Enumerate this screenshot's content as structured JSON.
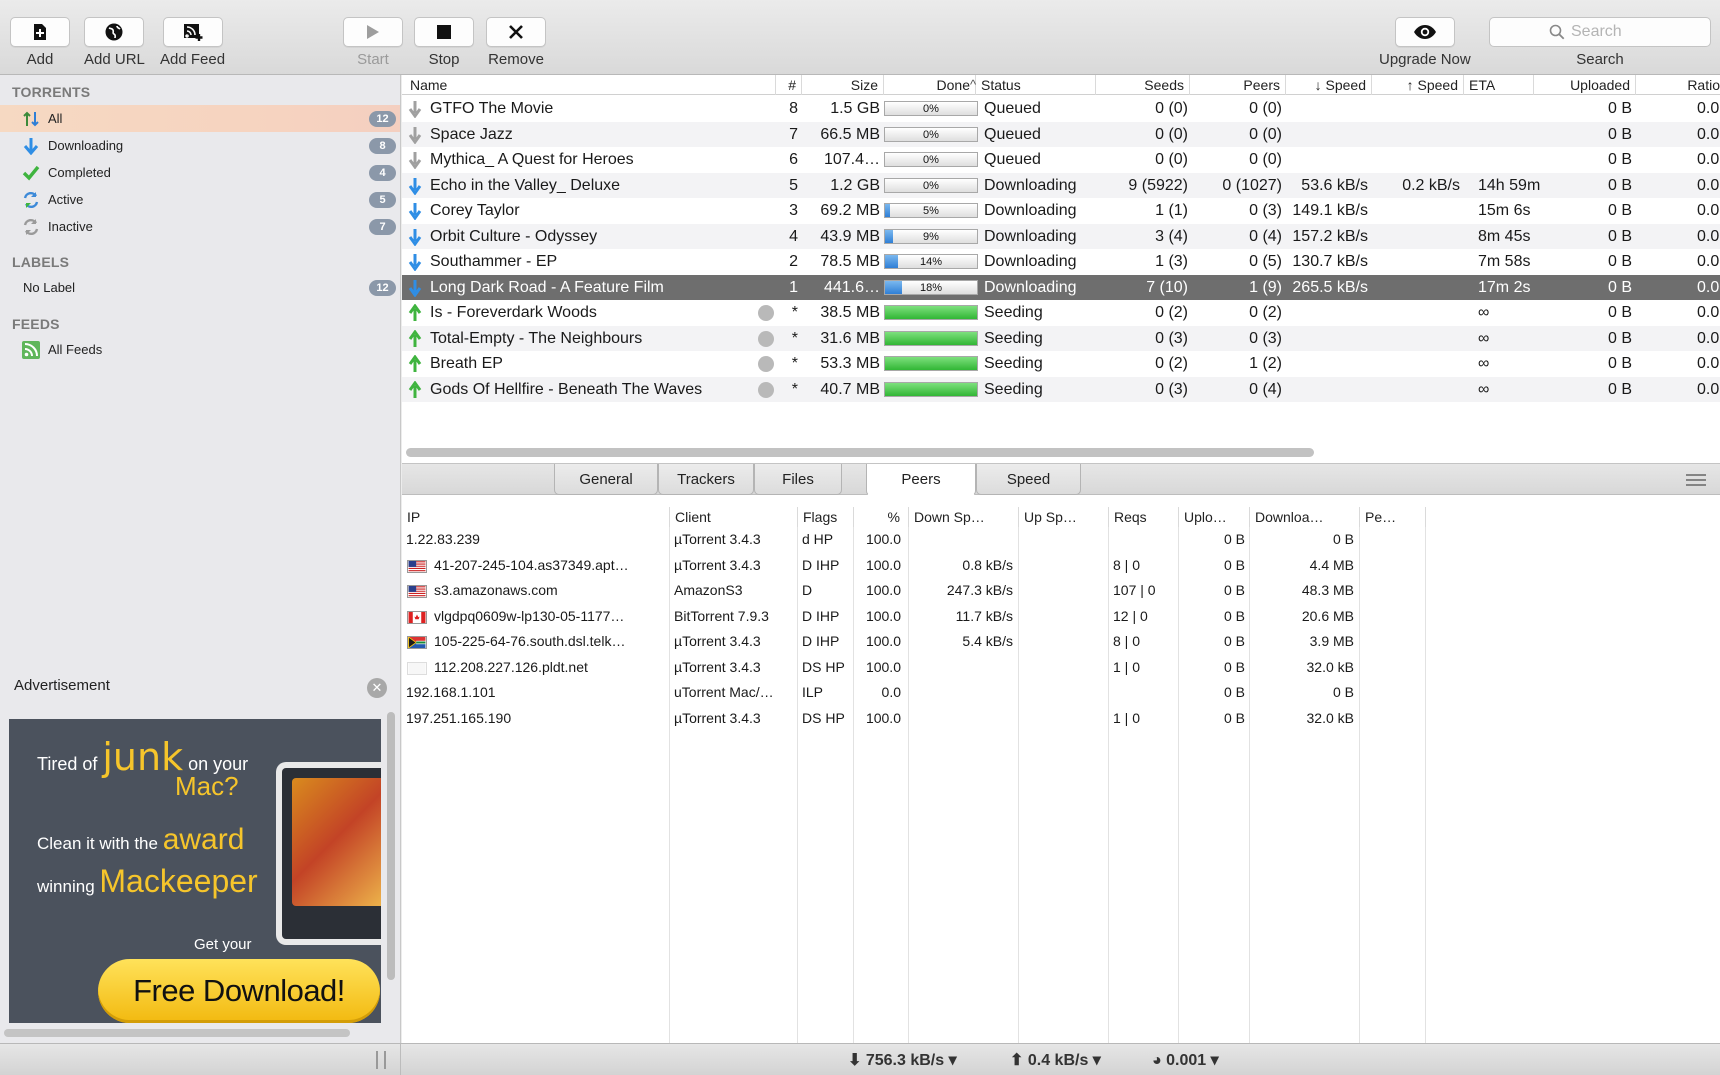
{
  "toolbar": {
    "add": "Add",
    "add_url": "Add URL",
    "add_feed": "Add Feed",
    "start": "Start",
    "stop": "Stop",
    "remove": "Remove",
    "upgrade": "Upgrade Now",
    "search_placeholder": "Search",
    "search_label": "Search"
  },
  "sidebar": {
    "torrents_header": "TORRENTS",
    "torrents": [
      {
        "label": "All",
        "count": "12",
        "icon": "all-icon"
      },
      {
        "label": "Downloading",
        "count": "8",
        "icon": "down-arrow-icon"
      },
      {
        "label": "Completed",
        "count": "4",
        "icon": "checkmark-icon"
      },
      {
        "label": "Active",
        "count": "5",
        "icon": "refresh-icon"
      },
      {
        "label": "Inactive",
        "count": "7",
        "icon": "refresh-gray-icon"
      }
    ],
    "labels_header": "LABELS",
    "labels": [
      {
        "label": "No Label",
        "count": "12"
      }
    ],
    "feeds_header": "FEEDS",
    "feeds": [
      {
        "label": "All Feeds",
        "icon": "rss-icon"
      }
    ],
    "ad_title": "Advertisement",
    "ad": {
      "line1a": "Tired of",
      "line1b": "junk",
      "line1c": "on your",
      "line2": "Mac?",
      "line3a": "Clean it with the",
      "line3b": "award",
      "line4a": "winning",
      "line4b": "Mackeeper",
      "line5": "Get your",
      "cta": "Free Download!"
    }
  },
  "torrents": {
    "columns": [
      "Name",
      "#",
      "Size",
      "Done",
      "Status",
      "Seeds",
      "Peers",
      "↓ Speed",
      "↑ Speed",
      "ETA",
      "Uploaded",
      "Ratio"
    ],
    "sort_indicator": "^",
    "rows": [
      {
        "name": "GTFO The Movie",
        "num": "8",
        "size": "1.5 GB",
        "done": 0,
        "done_label": "0%",
        "status": "Queued",
        "seeds": "0 (0)",
        "peers": "0 (0)",
        "down": "",
        "up": "",
        "eta": "",
        "uploaded": "0 B",
        "ratio": "0.0",
        "kind": "queued"
      },
      {
        "name": "Space Jazz",
        "num": "7",
        "size": "66.5 MB",
        "done": 0,
        "done_label": "0%",
        "status": "Queued",
        "seeds": "0 (0)",
        "peers": "0 (0)",
        "down": "",
        "up": "",
        "eta": "",
        "uploaded": "0 B",
        "ratio": "0.0",
        "kind": "queued"
      },
      {
        "name": "Mythica_ A Quest for Heroes",
        "num": "6",
        "size": "107.4…",
        "done": 0,
        "done_label": "0%",
        "status": "Queued",
        "seeds": "0 (0)",
        "peers": "0 (0)",
        "down": "",
        "up": "",
        "eta": "",
        "uploaded": "0 B",
        "ratio": "0.0",
        "kind": "queued"
      },
      {
        "name": "Echo in the Valley_ Deluxe",
        "num": "5",
        "size": "1.2 GB",
        "done": 0,
        "done_label": "0%",
        "status": "Downloading",
        "seeds": "9 (5922)",
        "peers": "0 (1027)",
        "down": "53.6 kB/s",
        "up": "0.2 kB/s",
        "eta": "14h 59m",
        "uploaded": "0 B",
        "ratio": "0.0",
        "kind": "down"
      },
      {
        "name": "Corey Taylor",
        "num": "3",
        "size": "69.2 MB",
        "done": 5,
        "done_label": "5%",
        "status": "Downloading",
        "seeds": "1 (1)",
        "peers": "0 (3)",
        "down": "149.1 kB/s",
        "up": "",
        "eta": "15m 6s",
        "uploaded": "0 B",
        "ratio": "0.0",
        "kind": "down"
      },
      {
        "name": "Orbit Culture - Odyssey",
        "num": "4",
        "size": "43.9 MB",
        "done": 9,
        "done_label": "9%",
        "status": "Downloading",
        "seeds": "3 (4)",
        "peers": "0 (4)",
        "down": "157.2 kB/s",
        "up": "",
        "eta": "8m 45s",
        "uploaded": "0 B",
        "ratio": "0.0",
        "kind": "down"
      },
      {
        "name": "Southammer - EP",
        "num": "2",
        "size": "78.5 MB",
        "done": 14,
        "done_label": "14%",
        "status": "Downloading",
        "seeds": "1 (3)",
        "peers": "0 (5)",
        "down": "130.7 kB/s",
        "up": "",
        "eta": "7m 58s",
        "uploaded": "0 B",
        "ratio": "0.0",
        "kind": "down"
      },
      {
        "name": "Long Dark Road - A Feature Film",
        "num": "1",
        "size": "441.6…",
        "done": 18,
        "done_label": "18%",
        "status": "Downloading",
        "seeds": "7 (10)",
        "peers": "1 (9)",
        "down": "265.5 kB/s",
        "up": "",
        "eta": "17m 2s",
        "uploaded": "0 B",
        "ratio": "0.0",
        "kind": "down",
        "selected": true
      },
      {
        "name": "Is - Foreverdark Woods",
        "num": "*",
        "size": "38.5 MB",
        "done": 100,
        "done_label": "",
        "status": "Seeding",
        "seeds": "0 (2)",
        "peers": "0 (2)",
        "down": "",
        "up": "",
        "eta": "∞",
        "uploaded": "0 B",
        "ratio": "0.0",
        "kind": "seed"
      },
      {
        "name": "Total-Empty - The Neighbours",
        "num": "*",
        "size": "31.6 MB",
        "done": 100,
        "done_label": "",
        "status": "Seeding",
        "seeds": "0 (3)",
        "peers": "0 (3)",
        "down": "",
        "up": "",
        "eta": "∞",
        "uploaded": "0 B",
        "ratio": "0.0",
        "kind": "seed"
      },
      {
        "name": "Breath EP",
        "num": "*",
        "size": "53.3 MB",
        "done": 100,
        "done_label": "",
        "status": "Seeding",
        "seeds": "0 (2)",
        "peers": "1 (2)",
        "down": "",
        "up": "",
        "eta": "∞",
        "uploaded": "0 B",
        "ratio": "0.0",
        "kind": "seed"
      },
      {
        "name": "Gods Of Hellfire - Beneath The Waves",
        "num": "*",
        "size": "40.7 MB",
        "done": 100,
        "done_label": "",
        "status": "Seeding",
        "seeds": "0 (3)",
        "peers": "0 (4)",
        "down": "",
        "up": "",
        "eta": "∞",
        "uploaded": "0 B",
        "ratio": "0.0",
        "kind": "seed"
      }
    ]
  },
  "tabs": [
    "General",
    "Trackers",
    "Files",
    "Peers",
    "Speed"
  ],
  "active_tab": "Peers",
  "peers": {
    "columns": [
      "IP",
      "Client",
      "Flags",
      "%",
      "Down Sp…",
      "Up Sp…",
      "Reqs",
      "Uplo…",
      "Downloa…",
      "Pe…"
    ],
    "rows": [
      {
        "ip": "1.22.83.239",
        "flag": "",
        "client": "µTorrent 3.4.3",
        "flags": "d HP",
        "pct": "100.0",
        "down": "",
        "up": "",
        "reqs": "",
        "uploaded": "0 B",
        "downloaded": "0 B"
      },
      {
        "ip": "41-207-245-104.as37349.apt…",
        "flag": "us",
        "client": "µTorrent 3.4.3",
        "flags": "D IHP",
        "pct": "100.0",
        "down": "0.8 kB/s",
        "up": "",
        "reqs": "8 | 0",
        "uploaded": "0 B",
        "downloaded": "4.4 MB"
      },
      {
        "ip": "s3.amazonaws.com",
        "flag": "us",
        "client": "AmazonS3",
        "flags": "D",
        "pct": "100.0",
        "down": "247.3 kB/s",
        "up": "",
        "reqs": "107 | 0",
        "uploaded": "0 B",
        "downloaded": "48.3 MB"
      },
      {
        "ip": "vlgdpq0609w-lp130-05-1177…",
        "flag": "ca",
        "client": "BitTorrent 7.9.3",
        "flags": "D IHP",
        "pct": "100.0",
        "down": "11.7 kB/s",
        "up": "",
        "reqs": "12 | 0",
        "uploaded": "0 B",
        "downloaded": "20.6 MB"
      },
      {
        "ip": "105-225-64-76.south.dsl.telk…",
        "flag": "za",
        "client": "µTorrent 3.4.3",
        "flags": "D IHP",
        "pct": "100.0",
        "down": "5.4 kB/s",
        "up": "",
        "reqs": "8 | 0",
        "uploaded": "0 B",
        "downloaded": "3.9 MB"
      },
      {
        "ip": "112.208.227.126.pldt.net",
        "flag": "blank",
        "client": "µTorrent 3.4.3",
        "flags": "DS HP",
        "pct": "100.0",
        "down": "",
        "up": "",
        "reqs": "1 | 0",
        "uploaded": "0 B",
        "downloaded": "32.0 kB"
      },
      {
        "ip": "192.168.1.101",
        "flag": "",
        "client": "uTorrent Mac/…",
        "flags": " ILP",
        "pct": "0.0",
        "down": "",
        "up": "",
        "reqs": "",
        "uploaded": "0 B",
        "downloaded": "0 B"
      },
      {
        "ip": "197.251.165.190",
        "flag": "",
        "client": "µTorrent 3.4.3",
        "flags": "DS HP",
        "pct": "100.0",
        "down": "",
        "up": "",
        "reqs": "1 | 0",
        "uploaded": "0 B",
        "downloaded": "32.0 kB"
      }
    ]
  },
  "status": {
    "down_speed": "756.3 kB/s",
    "up_speed": "0.4 kB/s",
    "ratio": "0.001"
  },
  "colors": {
    "selected_row": "#6e6e6e",
    "sidebar_selected": "#f6d9c2",
    "progress_blue": "#2f7fd6",
    "progress_green": "#31b635",
    "badge": "#8b98a9"
  }
}
